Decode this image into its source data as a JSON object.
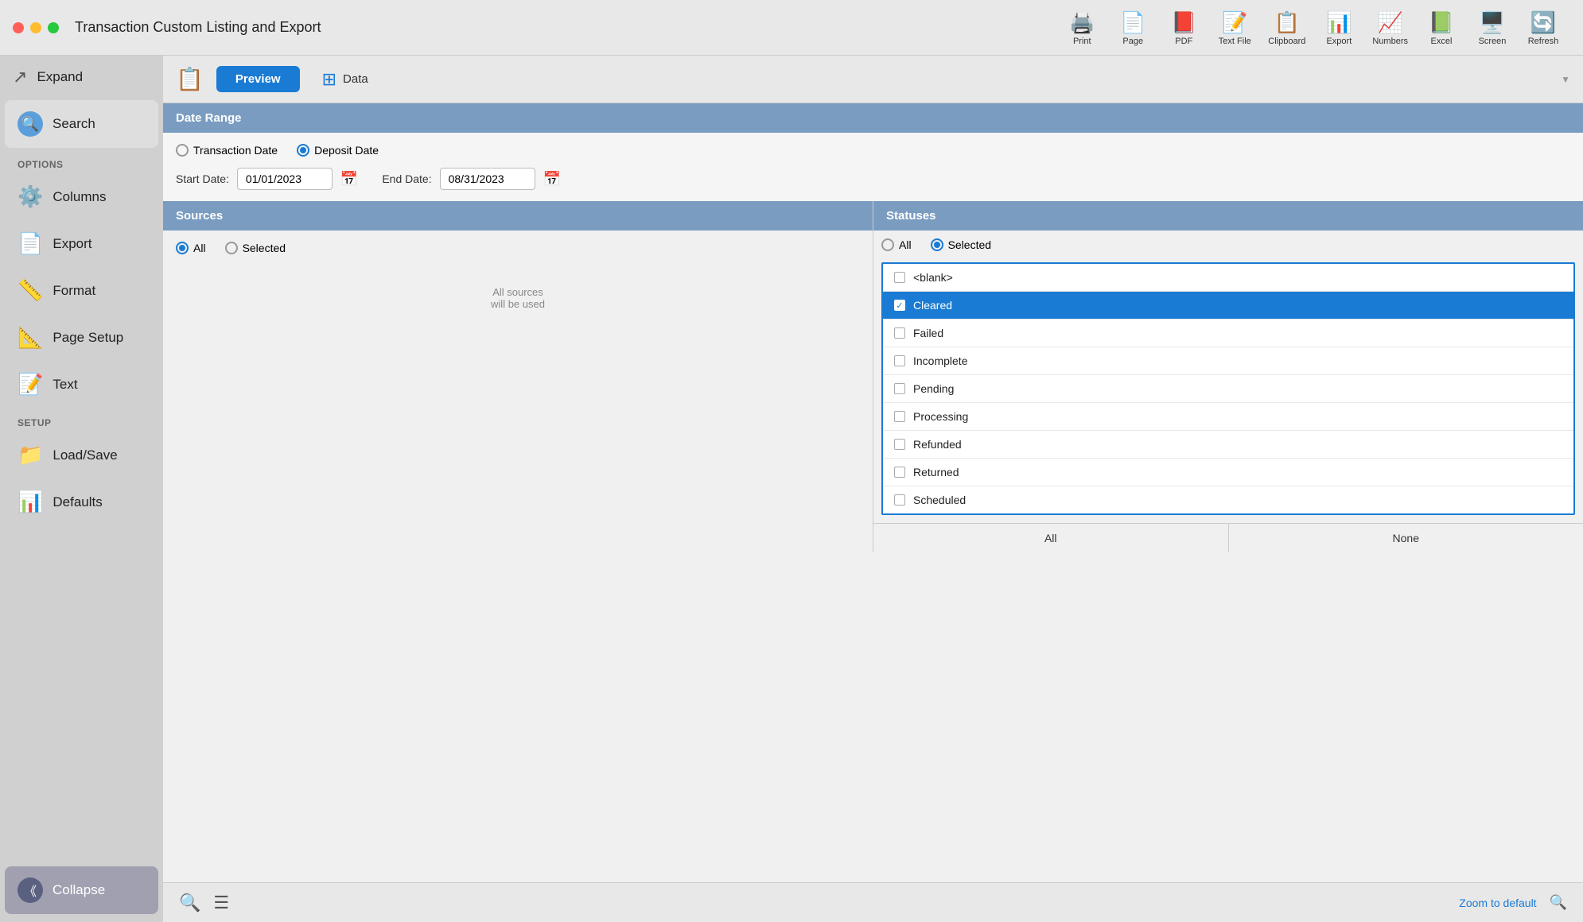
{
  "app": {
    "title": "Transaction Custom Listing and Export"
  },
  "toolbar": {
    "items": [
      {
        "id": "print",
        "label": "Print",
        "icon": "🖨️"
      },
      {
        "id": "page",
        "label": "Page",
        "icon": "📄"
      },
      {
        "id": "pdf",
        "label": "PDF",
        "icon": "📕"
      },
      {
        "id": "text-file",
        "label": "Text File",
        "icon": "📝"
      },
      {
        "id": "clipboard",
        "label": "Clipboard",
        "icon": "📋"
      },
      {
        "id": "export",
        "label": "Export",
        "icon": "📊"
      },
      {
        "id": "numbers",
        "label": "Numbers",
        "icon": "📈"
      },
      {
        "id": "excel",
        "label": "Excel",
        "icon": "📗"
      },
      {
        "id": "screen",
        "label": "Screen",
        "icon": "🖥️"
      },
      {
        "id": "refresh",
        "label": "Refresh",
        "icon": "🔄"
      }
    ]
  },
  "preview_bar": {
    "preview_label": "Preview",
    "data_label": "Data"
  },
  "sidebar": {
    "expand_label": "Expand",
    "search_label": "Search",
    "options_section": "OPTIONS",
    "items": [
      {
        "id": "columns",
        "label": "Columns",
        "icon": "⚙️"
      },
      {
        "id": "export",
        "label": "Export",
        "icon": "📄"
      },
      {
        "id": "format",
        "label": "Format",
        "icon": "📏"
      },
      {
        "id": "page-setup",
        "label": "Page Setup",
        "icon": "📐"
      },
      {
        "id": "text",
        "label": "Text",
        "icon": "📝"
      }
    ],
    "setup_section": "SETUP",
    "setup_items": [
      {
        "id": "load-save",
        "label": "Load/Save",
        "icon": "📁"
      },
      {
        "id": "defaults",
        "label": "Defaults",
        "icon": "📊"
      }
    ],
    "collapse_label": "Collapse"
  },
  "date_range": {
    "section_label": "Date Range",
    "transaction_date_label": "Transaction Date",
    "deposit_date_label": "Deposit Date",
    "deposit_date_selected": true,
    "start_date_label": "Start Date:",
    "start_date_value": "01/01/2023",
    "end_date_label": "End Date:",
    "end_date_value": "08/31/2023"
  },
  "sources": {
    "section_label": "Sources",
    "all_label": "All",
    "selected_label": "Selected",
    "all_selected": true,
    "note_line1": "All sources",
    "note_line2": "will be used"
  },
  "statuses": {
    "section_label": "Statuses",
    "all_label": "All",
    "selected_label": "Selected",
    "selected_active": true,
    "items": [
      {
        "id": "blank",
        "label": "<blank>",
        "checked": false
      },
      {
        "id": "cleared",
        "label": "Cleared",
        "checked": true,
        "highlighted": true
      },
      {
        "id": "failed",
        "label": "Failed",
        "checked": false
      },
      {
        "id": "incomplete",
        "label": "Incomplete",
        "checked": false
      },
      {
        "id": "pending",
        "label": "Pending",
        "checked": false
      },
      {
        "id": "processing",
        "label": "Processing",
        "checked": false
      },
      {
        "id": "refunded",
        "label": "Refunded",
        "checked": false
      },
      {
        "id": "returned",
        "label": "Returned",
        "checked": false
      },
      {
        "id": "scheduled",
        "label": "Scheduled",
        "checked": false
      }
    ],
    "footer_all": "All",
    "footer_none": "None"
  },
  "bottom_bar": {
    "zoom_label": "Zoom to default"
  }
}
